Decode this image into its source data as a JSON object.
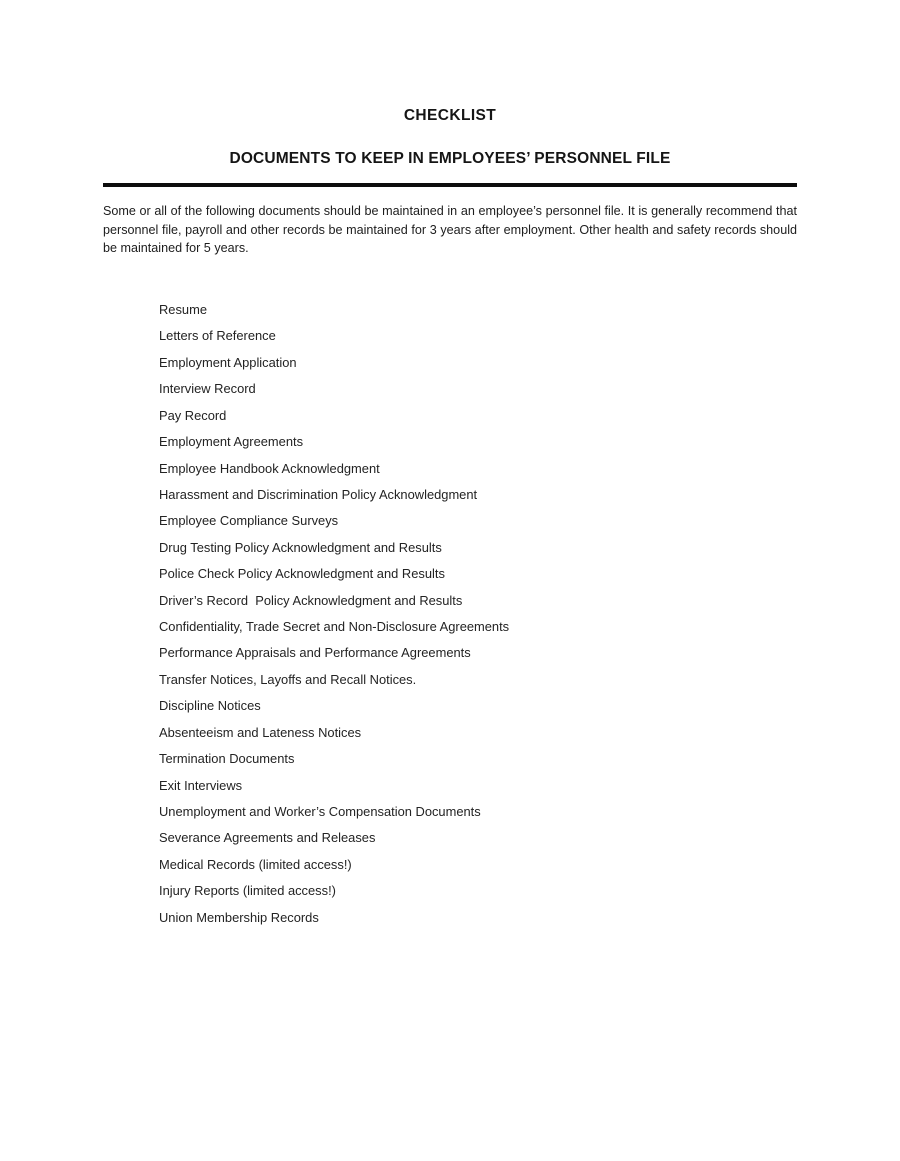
{
  "document": {
    "title": "CHECKLIST",
    "subtitle": "DOCUMENTS TO KEEP IN EMPLOYEES’ PERSONNEL FILE",
    "intro": "Some or all of the following documents should be maintained in an employee’s personnel file. It is generally recommend that personnel file, payroll and other records be maintained for 3 years after employment. Other health and safety records should be maintained for 5 years.",
    "items": [
      "Resume",
      "Letters of Reference",
      "Employment Application",
      "Interview Record",
      "Pay Record",
      "Employment Agreements",
      "Employee Handbook Acknowledgment",
      "Harassment and Discrimination Policy Acknowledgment",
      "Employee Compliance Surveys",
      "Drug Testing Policy Acknowledgment and Results",
      "Police Check Policy Acknowledgment and Results",
      "Driver’s Record  Policy Acknowledgment and Results",
      "Confidentiality, Trade Secret and Non-Disclosure Agreements",
      "Performance Appraisals and Performance Agreements",
      "Transfer Notices, Layoffs and Recall Notices.",
      "Discipline Notices",
      "Absenteeism and Lateness Notices",
      "Termination Documents",
      "Exit Interviews",
      "Unemployment and Worker’s Compensation Documents",
      "Severance Agreements and Releases",
      "Medical Records (limited access!)",
      "Injury Reports (limited access!)",
      "Union Membership Records"
    ],
    "colors": {
      "page_background": "#ffffff",
      "text": "#1d1d1d",
      "heading": "#151515",
      "rule": "#0d0d0d"
    }
  }
}
